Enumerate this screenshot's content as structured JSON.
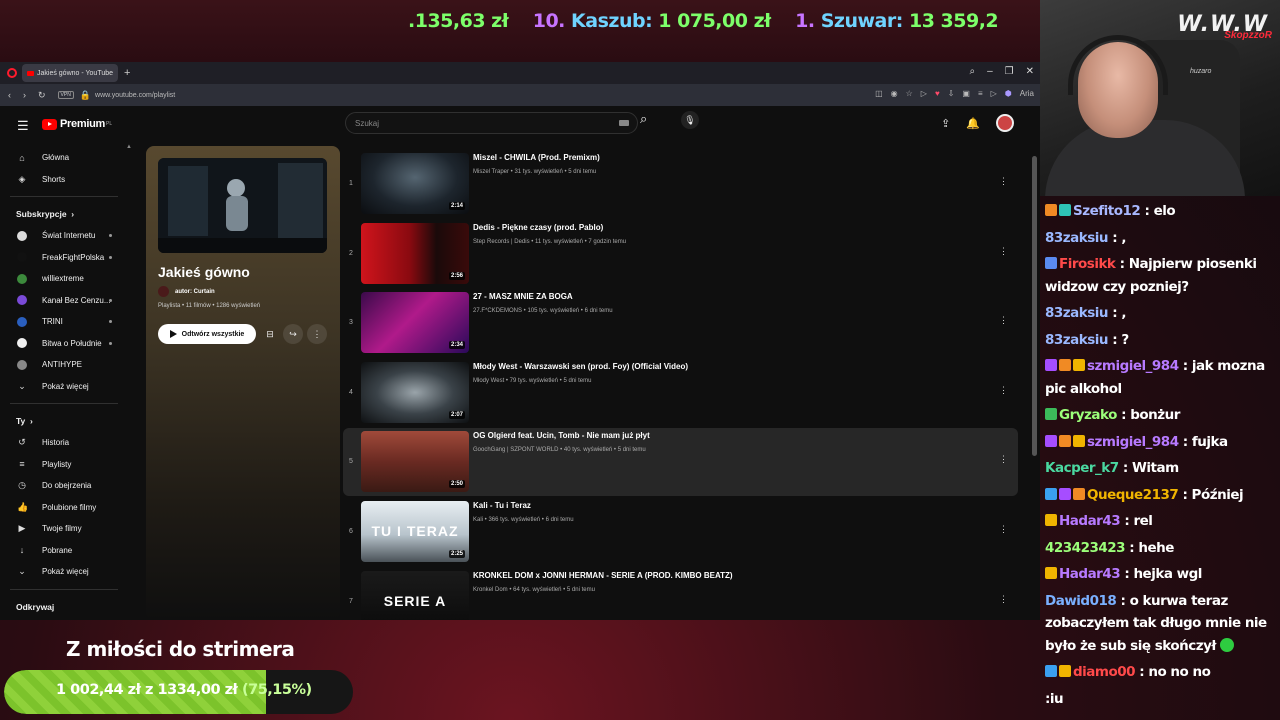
{
  "ticker": {
    "items": [
      {
        "rank": "",
        "name": "",
        "value": ".135,63 zł"
      },
      {
        "rank": "10.",
        "name": "Kaszub:",
        "value": "1 075,00 zł"
      },
      {
        "rank": "1.",
        "name": "Szuwar:",
        "value": "13 359,2"
      }
    ]
  },
  "browser": {
    "tab_title": "Jakieś gówno - YouTube",
    "url": "www.youtube.com/playlist",
    "vpn_label": "VPN",
    "ai_label": "Aria"
  },
  "youtube": {
    "logo_text": "Premium",
    "logo_region": "PL",
    "search_placeholder": "Szukaj",
    "sidebar": {
      "main": [
        {
          "label": "Główna",
          "icon": "home-icon",
          "glyph": "⌂"
        },
        {
          "label": "Shorts",
          "icon": "shorts-icon",
          "glyph": "◈"
        }
      ],
      "subscriptions_label": "Subskrypcje",
      "subscriptions": [
        {
          "label": "Świat Internetu",
          "color": "#dcdcdc",
          "live": true
        },
        {
          "label": "FreakFightPolska",
          "color": "#111111",
          "live": true
        },
        {
          "label": "williextreme",
          "color": "#3c8a3c",
          "live": false
        },
        {
          "label": "Kanał Bez Cenzu...",
          "color": "#7a4ad8",
          "live": true
        },
        {
          "label": "TRINI",
          "color": "#2a5fbf",
          "live": true
        },
        {
          "label": "Bitwa o Południe",
          "color": "#f0f0f0",
          "live": true
        },
        {
          "label": "ANTIHYPE",
          "color": "#888888",
          "live": false
        }
      ],
      "show_more": "Pokaż więcej",
      "you_label": "Ty",
      "you_items": [
        {
          "label": "Historia",
          "icon": "history-icon",
          "glyph": "↺"
        },
        {
          "label": "Playlisty",
          "icon": "playlists-icon",
          "glyph": "≡"
        },
        {
          "label": "Do obejrzenia",
          "icon": "watch-later-icon",
          "glyph": "◷"
        },
        {
          "label": "Polubione filmy",
          "icon": "liked-icon",
          "glyph": "👍"
        },
        {
          "label": "Twoje filmy",
          "icon": "your-videos-icon",
          "glyph": "▶"
        },
        {
          "label": "Pobrane",
          "icon": "download-icon",
          "glyph": "↓"
        },
        {
          "label": "Pokaż więcej",
          "icon": "chevron-down-icon",
          "glyph": "⌄"
        }
      ],
      "explore_label": "Odkrywaj"
    },
    "playlist": {
      "title": "Jakieś gówno",
      "author": "autor: Curtain",
      "meta": "Playlista • 11 filmów • 1286 wyświetleń",
      "play_all": "Odtwórz wszystkie"
    },
    "videos": [
      {
        "index": "1",
        "title": "Miszel - CHWILA (Prod. Premixm)",
        "meta": "Miszel Traper • 31 tys. wyświetleń • 5 dni temu",
        "duration": "2:14",
        "thumb_text": "",
        "bg": "radial-gradient(ellipse at 50% 40%, #556571 0%, #1d252d 55%, #0b0d10 100%)",
        "active": false
      },
      {
        "index": "2",
        "title": "Dedis - Piękne czasy (prod. Pablo)",
        "meta": "Step Records | Dedis • 11 tys. wyświetleń • 7 godzin temu",
        "duration": "2:56",
        "thumb_text": "",
        "bg": "linear-gradient(90deg, #d0141c 0%, #8a0a10 45%, #1a0a0a 70%, #3a0a0a 100%)",
        "active": false
      },
      {
        "index": "3",
        "title": "27 - MASZ MNIE ZA BOGA",
        "meta": "27.F*CKDEMONS • 105 tys. wyświetleń • 6 dni temu",
        "duration": "2:34",
        "thumb_text": "",
        "bg": "linear-gradient(135deg, #3a0a4a 0%, #b01a8a 45%, #2a0a5a 100%)",
        "active": false
      },
      {
        "index": "4",
        "title": "Młody West - Warszawski sen (prod. Foy) (Official Video)",
        "meta": "Młody West • 79 tys. wyświetleń • 5 dni temu",
        "duration": "2:07",
        "thumb_text": "",
        "bg": "radial-gradient(ellipse at 50% 50%, #9aa4aa 0%, #3a4248 50%, #0e1012 100%)",
        "active": false
      },
      {
        "index": "5",
        "title": "OG Olgierd feat. Ucin, Tomb - Nie mam już płyt",
        "meta": "GoochGang | SZPONT WORLD • 40 tys. wyświetleń • 5 dni temu",
        "duration": "2:50",
        "thumb_text": "",
        "bg": "linear-gradient(180deg, #a04a3a 0%, #6a2a22 50%, #3a1a14 100%)",
        "active": true
      },
      {
        "index": "6",
        "title": "Kali - Tu i Teraz",
        "meta": "Kali • 366 tys. wyświetleń • 6 dni temu",
        "duration": "2:25",
        "thumb_text": "TU I TERAZ",
        "bg": "linear-gradient(180deg, #e8eef2 0%, #b8c4cc 55%, #4a5258 100%)",
        "active": false
      },
      {
        "index": "7",
        "title": "KRONKEL DOM x JONNI HERMAN - SERIE A (PROD. KIMBO BEATZ)",
        "meta": "Kronkel Dom • 64 tys. wyświetleń • 5 dni temu",
        "duration": "",
        "thumb_text": "SERIE A",
        "bg": "linear-gradient(180deg, #1a1a1a 0%, #0a0a0a 100%)",
        "active": false
      }
    ]
  },
  "webcam": {
    "neon_text": "W.W.W",
    "neon_red": "SkopzzoR",
    "chair_text": "huzaro"
  },
  "chat": {
    "messages": [
      {
        "user": "Szefito12",
        "text": ": elo",
        "color": "#a8b8ff",
        "badges": [
          "#f08a24",
          "#2ec4b6"
        ],
        "lines": 1
      },
      {
        "user": "83zaksiu",
        "text": ": ,",
        "color": "#9ab8ff",
        "badges": [],
        "lines": 1
      },
      {
        "user": "Firosikk",
        "text": ": Najpierw piosenki widzow czy pozniej?",
        "color": "#ff4a4a",
        "badges": [
          "#5a8af0"
        ],
        "lines": 2
      },
      {
        "user": "83zaksiu",
        "text": ": ,",
        "color": "#9ab8ff",
        "badges": [],
        "lines": 1
      },
      {
        "user": "83zaksiu",
        "text": ": ?",
        "color": "#9ab8ff",
        "badges": [],
        "lines": 1
      },
      {
        "user": "szmigiel_984",
        "text": ": jak mozna pic alkohol",
        "color": "#b77aff",
        "badges": [
          "#a64dff",
          "#f08a24",
          "#f0b400"
        ],
        "lines": 2
      },
      {
        "user": "Gryzako",
        "text": ": bonżur",
        "color": "#9cff7a",
        "badges": [
          "#3cba5a"
        ],
        "lines": 1
      },
      {
        "user": "szmigiel_984",
        "text": ": fujka",
        "color": "#b77aff",
        "badges": [
          "#a64dff",
          "#f08a24",
          "#f0b400"
        ],
        "lines": 1
      },
      {
        "user": "Kacper_k7",
        "text": ": Witam",
        "color": "#4ad8a0",
        "badges": [],
        "lines": 1
      },
      {
        "user": "Queque2137",
        "text": ": Później",
        "color": "#f0b400",
        "badges": [
          "#3aa0f0",
          "#a64dff",
          "#f08a24"
        ],
        "lines": 1
      },
      {
        "user": "Hadar43",
        "text": ": rel",
        "color": "#b77aff",
        "badges": [
          "#f0b400"
        ],
        "lines": 1
      },
      {
        "user": "423423423",
        "text": ": hehe",
        "color": "#9cff7a",
        "badges": [],
        "lines": 1
      },
      {
        "user": "Hadar43",
        "text": ": hejka wgl",
        "color": "#b77aff",
        "badges": [
          "#f0b400"
        ],
        "lines": 1
      },
      {
        "user": "Dawid018",
        "text": ": o kurwa teraz zobaczyłem tak długo mnie nie było że sub się skończył",
        "color": "#7ab0ff",
        "badges": [],
        "lines": 3
      },
      {
        "user": "diamo00",
        "text": ": no no no",
        "color": "#ff4a4a",
        "badges": [
          "#3aa0f0",
          "#f0b400"
        ],
        "lines": 1
      },
      {
        "user": "",
        "text": ":iu",
        "color": "#ffffff",
        "badges": [],
        "lines": 1
      }
    ]
  },
  "goal": {
    "title": "Z miłości do strimera",
    "text": "1 002,44 zł z 1334,00 zł",
    "percent_label": "(75,15%)",
    "progress": 0.7515
  }
}
